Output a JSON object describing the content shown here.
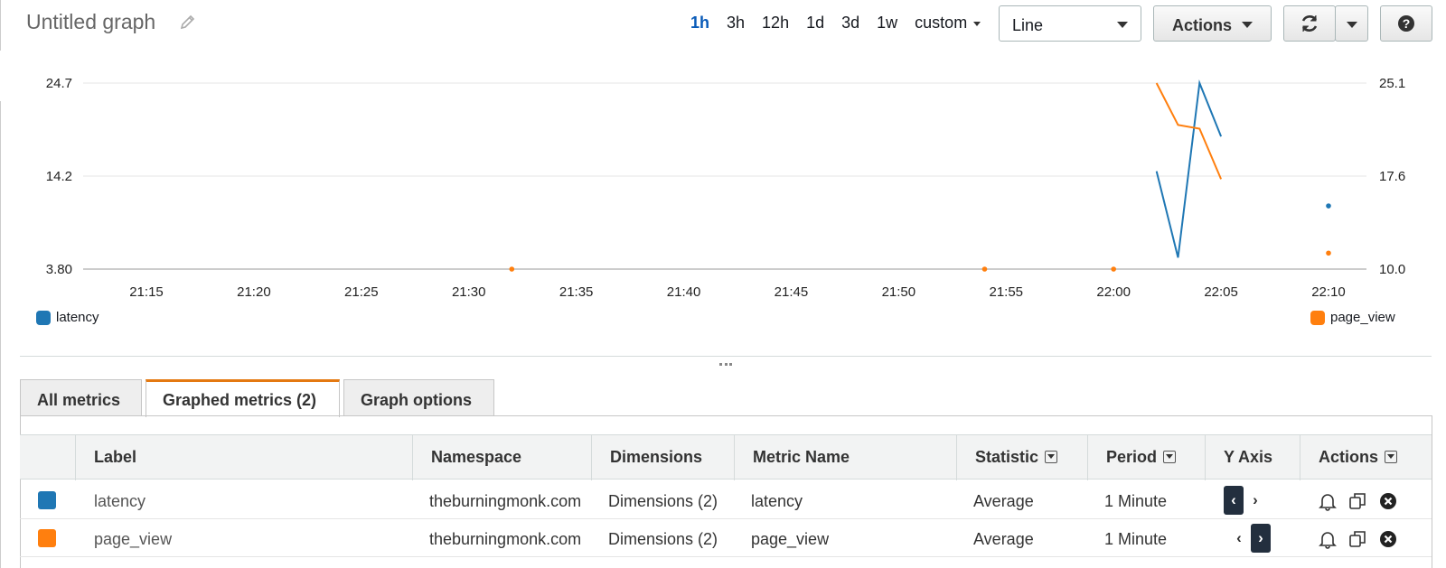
{
  "header": {
    "title": "Untitled graph",
    "ranges": [
      {
        "label": "1h",
        "active": true
      },
      {
        "label": "3h",
        "active": false
      },
      {
        "label": "12h",
        "active": false
      },
      {
        "label": "1d",
        "active": false
      },
      {
        "label": "3d",
        "active": false
      },
      {
        "label": "1w",
        "active": false
      }
    ],
    "custom_label": "custom",
    "chart_type_value": "Line",
    "actions_label": "Actions"
  },
  "chart_data": {
    "type": "line",
    "x_ticks": [
      "21:15",
      "21:20",
      "21:25",
      "21:30",
      "21:35",
      "21:40",
      "21:45",
      "21:50",
      "21:55",
      "22:00",
      "22:05",
      "22:10"
    ],
    "y_left_ticks": [
      "24.7",
      "14.2",
      "3.80"
    ],
    "y_right_ticks": [
      "25.1",
      "17.6",
      "10.0"
    ],
    "y_left_range": [
      3.8,
      24.7
    ],
    "y_right_range": [
      10.0,
      25.1
    ],
    "grid": true,
    "series": [
      {
        "name": "latency",
        "color": "#1f77b4",
        "axis": "left",
        "points": [
          {
            "x": "22:02",
            "y": 14.8
          },
          {
            "x": "22:03",
            "y": 5.1
          },
          {
            "x": "22:04",
            "y": 24.7
          },
          {
            "x": "22:05",
            "y": 18.7
          },
          {
            "x": "22:10",
            "y": 10.9
          }
        ],
        "line_segments": [
          [
            0,
            3
          ]
        ],
        "dots": [
          4
        ]
      },
      {
        "name": "page_view",
        "color": "#ff7f0e",
        "axis": "right",
        "points": [
          {
            "x": "21:32",
            "y": 10.0
          },
          {
            "x": "21:54",
            "y": 10.0
          },
          {
            "x": "22:00",
            "y": 10.0
          },
          {
            "x": "22:02",
            "y": 25.1
          },
          {
            "x": "22:03",
            "y": 21.7
          },
          {
            "x": "22:04",
            "y": 21.4
          },
          {
            "x": "22:05",
            "y": 17.3
          },
          {
            "x": "22:10",
            "y": 11.3
          }
        ],
        "line_segments": [
          [
            3,
            6
          ]
        ],
        "dots": [
          0,
          1,
          2,
          7
        ]
      }
    ],
    "legend": [
      {
        "name": "latency",
        "color": "#1f77b4",
        "position": "bottom-left"
      },
      {
        "name": "page_view",
        "color": "#ff7f0e",
        "position": "bottom-right"
      }
    ]
  },
  "tabs": [
    {
      "label": "All metrics",
      "active": false
    },
    {
      "label": "Graphed metrics (2)",
      "active": true
    },
    {
      "label": "Graph options",
      "active": false
    }
  ],
  "table": {
    "columns": [
      "Label",
      "Namespace",
      "Dimensions",
      "Metric Name",
      "Statistic",
      "Period",
      "Y Axis",
      "Actions"
    ],
    "rows": [
      {
        "color": "#1f77b4",
        "label": "latency",
        "namespace": "theburningmonk.com",
        "dimensions": "Dimensions (2)",
        "metric": "latency",
        "statistic": "Average",
        "period": "1 Minute",
        "yaxis": "left"
      },
      {
        "color": "#ff7f0e",
        "label": "page_view",
        "namespace": "theburningmonk.com",
        "dimensions": "Dimensions (2)",
        "metric": "page_view",
        "statistic": "Average",
        "period": "1 Minute",
        "yaxis": "right"
      }
    ]
  }
}
